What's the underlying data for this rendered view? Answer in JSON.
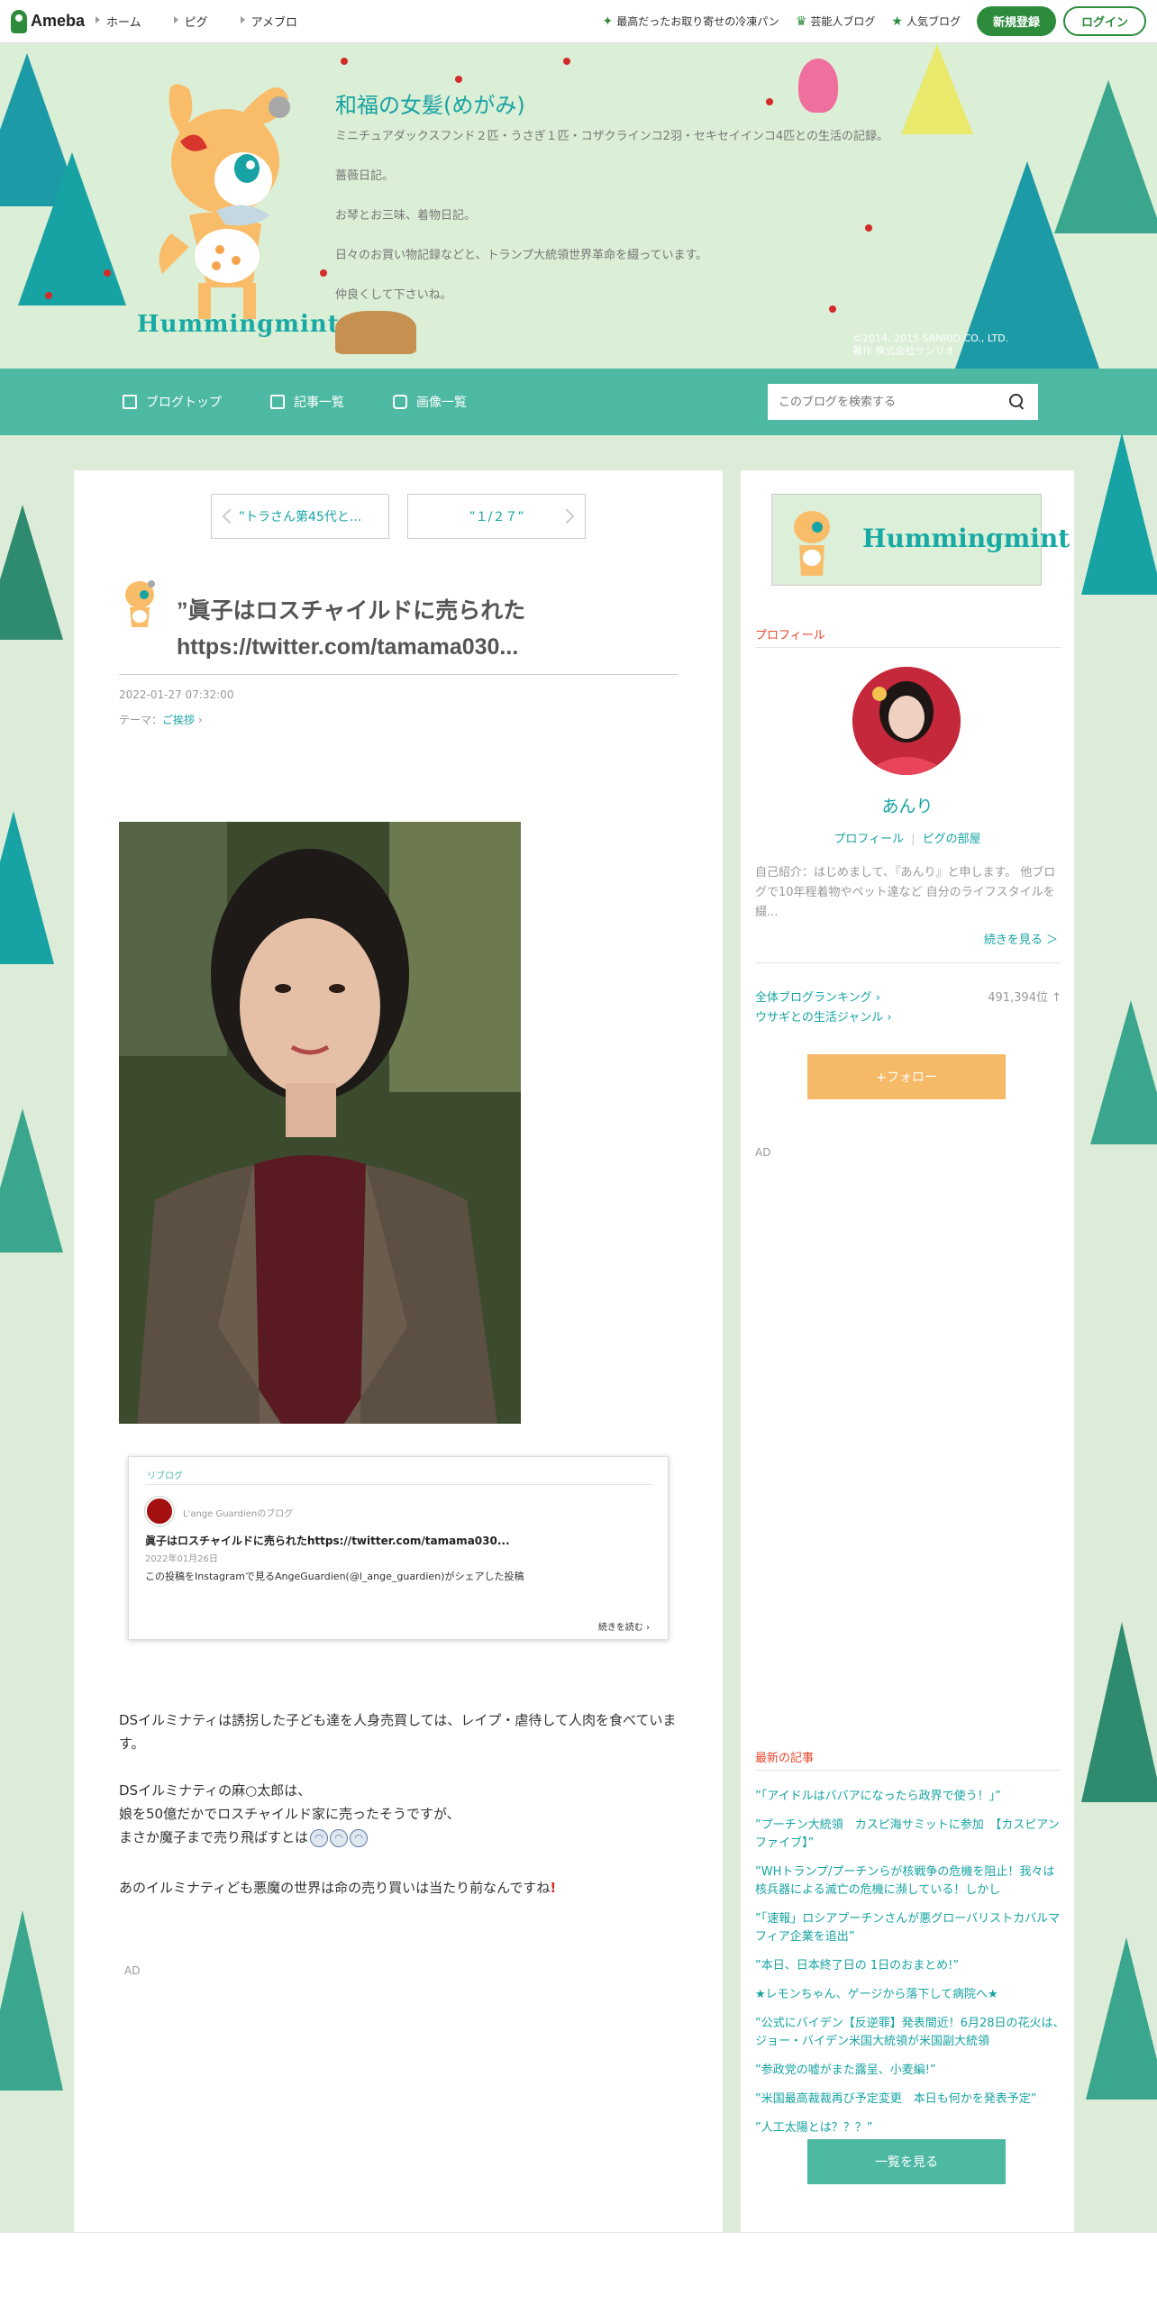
{
  "topbar": {
    "logo": "Ameba",
    "nav": [
      "ホーム",
      "ピグ",
      "アメブロ"
    ],
    "links": [
      "最高だったお取り寄せの冷凍パン",
      "芸能人ブログ",
      "人気ブログ"
    ],
    "signup": "新規登録",
    "login": "ログイン"
  },
  "header": {
    "title": "和福の女髪(めがみ)",
    "desc": [
      "ミニチュアダックスフンド２匹・うさぎ１匹・コザクラインコ2羽・セキセイインコ4匹との生活の記録。",
      "薔薇日記。",
      "お琴とお三味、着物日記。",
      "日々のお買い物記録などと、トランプ大統領世界革命を綴っています。",
      "仲良くして下さいね。"
    ],
    "brand": "Hummingmint",
    "copyright1": "©2014, 2015 SANRIO CO., LTD.",
    "copyright2": "著作 株式会社サンリオ"
  },
  "blognav": {
    "items": [
      "ブログトップ",
      "記事一覧",
      "画像一覧"
    ],
    "search_placeholder": "このブログを検索する"
  },
  "entry": {
    "prev": "”トラさん第45代と...",
    "next": "”１/２７”",
    "title": "”眞子はロスチャイルドに売られた https://twitter.com/tamama030...",
    "date": "2022-01-27 07:32:00",
    "theme_label": "テーマ：",
    "theme": "ご挨拶",
    "reblog": {
      "label": "リブログ",
      "source": "L'ange Guardienのブログ",
      "title": "眞子はロスチャイルドに売られたhttps://twitter.com/tamama030...",
      "date": "2022年01月26日",
      "text": "この投稿をInstagramで見るAngeGuardien(@l_ange_guardien)がシェアした投稿",
      "more": "続きを読む"
    },
    "body": [
      "DSイルミナティは誘拐した子ども達を人身売買しては、レイプ・虐待して人肉を食べています。",
      "DSイルミナティの麻○太郎は、",
      "娘を50億だかでロスチャイルド家に売ったそうですが、",
      "まさか魔子まで売り飛ばすとは",
      "あのイルミナティども悪魔の世界は命の売り買いは当たり前なんですね"
    ],
    "ad": "AD"
  },
  "sidebar": {
    "banner": "Hummingmint",
    "profile_head": "プロフィール",
    "name": "あんり",
    "link_profile": "プロフィール",
    "link_pig": "ピグの部屋",
    "intro": "自己紹介：はじめまして、『あんり』と申します。 他ブログで10年程着物やペット達など 自分のライフスタイルを綴...",
    "more": "続きを見る ＞",
    "rank_label": "全体ブログランキング",
    "rank_value": "491,394位 ↑",
    "genre": "ウサギとの生活ジャンル",
    "follow": "+フォロー",
    "ad": "AD",
    "recent_head": "最新の記事",
    "recent": [
      "”「アイドルはババアになったら政界で使う！」”",
      "”プーチン大統領　カスピ海サミットに参加　【カスピアンファイブ】”",
      "”WHトランプ/プーチンらが核戦争の危機を阻止！我々は核兵器による滅亡の危機に瀕している！しかし",
      "”「速報」ロシアプーチンさんが悪グローバリストカバルマフィア企業を追出”",
      "”本日、日本終了日の 1日のおまとめ!”",
      "★レモンちゃん、ゲージから落下して病院へ★",
      "”公式にバイデン【反逆罪】発表間近！6月28日の花火は、ジョー・バイデン米国大統領が米国副大統領",
      "”参政党の嘘がまた露呈、小麦編!”",
      "”米国最高裁裁再び予定変更　本日も何かを発表予定”",
      "”人工太陽とは？？？”"
    ],
    "list_btn": "一覧を見る"
  },
  "colors": {
    "accent": "#4db9a3",
    "link": "#17a3a3",
    "brand": "#2d8c3c",
    "follow": "#f6b967"
  }
}
